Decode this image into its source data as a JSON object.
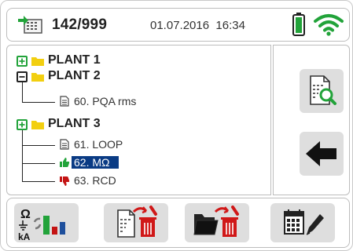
{
  "header": {
    "memory_count": "142/999",
    "datetime": "01.07.2016  16:34",
    "icons": [
      "memory-icon",
      "battery-icon",
      "wifi-icon"
    ],
    "battery_color": "#22a33a",
    "wifi_color": "#22a33a"
  },
  "tree": {
    "plants": [
      {
        "label": "PLANT 1",
        "expanded": false,
        "records": []
      },
      {
        "label": "PLANT 2",
        "expanded": true,
        "records": [
          {
            "label": "60. PQA rms",
            "status": "none"
          }
        ]
      },
      {
        "label": "PLANT 3",
        "expanded": true,
        "records": [
          {
            "label": "61. LOOP",
            "status": "none"
          },
          {
            "label": "62. MΩ",
            "status": "pass",
            "selected": true
          },
          {
            "label": "63. RCD",
            "status": "fail"
          }
        ]
      }
    ],
    "selected_color": "#0a3b84",
    "pass_color": "#22a33a",
    "fail_color": "#c41414",
    "folder_color": "#f2cf10"
  },
  "side_buttons": [
    "view-record-icon",
    "back-arrow-icon"
  ],
  "bottom_buttons": [
    "measure-icon",
    "delete-record-icon",
    "delete-plant-icon",
    "edit-calendar-icon"
  ],
  "bottom_measure_symbols": {
    "top": "Ω",
    "bottom": "kA"
  },
  "delete_color": "#d01818"
}
